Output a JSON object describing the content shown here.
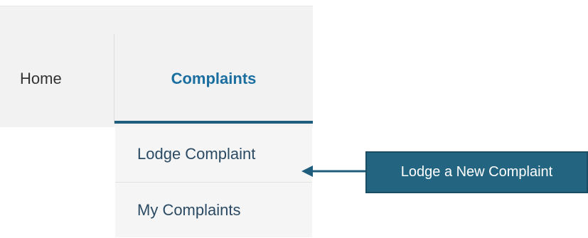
{
  "nav": {
    "home_label": "Home",
    "complaints_label": "Complaints"
  },
  "dropdown": {
    "items": [
      {
        "label": "Lodge Complaint"
      },
      {
        "label": "My Complaints"
      }
    ]
  },
  "annotation": {
    "callout_text": "Lodge a New Complaint"
  },
  "colors": {
    "accent": "#1f5d7c",
    "active_tab_text": "#1b6ea0",
    "callout_bg": "#236581"
  }
}
